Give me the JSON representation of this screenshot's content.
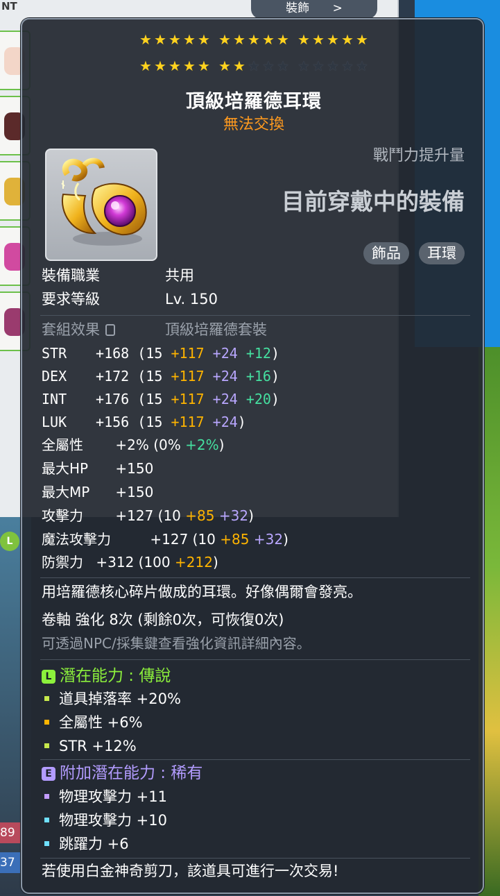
{
  "background": {
    "equip_window_title": "NT",
    "tab_button_label": "裝飾",
    "tab_button_arrow": ">",
    "level_badge": "L",
    "hp_text": "89",
    "mp_text": "37"
  },
  "tooltip": {
    "stars": {
      "total": 25,
      "filled": 22,
      "rows": [
        [
          [
            1,
            1,
            1,
            1,
            1
          ],
          [
            1,
            1,
            1,
            1,
            1
          ],
          [
            1,
            1,
            1,
            1,
            1
          ]
        ],
        [
          [
            1,
            1,
            1,
            1,
            1
          ],
          [
            1,
            1,
            0,
            0,
            0
          ],
          [
            0,
            0,
            0,
            0,
            0
          ]
        ]
      ]
    },
    "title": "頂級培羅德耳環",
    "trade_status": "無法交換",
    "combat_power_label": "戰鬥力提升量",
    "equipped_label": "目前穿戴中的裝備",
    "tags": [
      "飾品",
      "耳環"
    ],
    "job": {
      "label": "裝備職業",
      "value": "共用"
    },
    "req_level": {
      "label": "要求等級",
      "value": "Lv. 150"
    },
    "set": {
      "label": "套組效果",
      "value": "頂級培羅德套裝"
    },
    "stats": [
      {
        "name": "STR",
        "total": "+168",
        "base": "(15",
        "flame": "+117",
        "enhance": "+24",
        "extra": "+12",
        "close": ")"
      },
      {
        "name": "DEX",
        "total": "+172",
        "base": "(15",
        "flame": "+117",
        "enhance": "+24",
        "extra": "+16",
        "close": ")"
      },
      {
        "name": "INT",
        "total": "+176",
        "base": "(15",
        "flame": "+117",
        "enhance": "+24",
        "extra": "+20",
        "close": ")"
      },
      {
        "name": "LUK",
        "total": "+156",
        "base": "(15",
        "flame": "+117",
        "enhance": "+24",
        "extra": "",
        "close": ")"
      }
    ],
    "all_stat": {
      "name": "全屬性",
      "total": "+2%",
      "base": "(0%",
      "extra": "+2%",
      "close": ")"
    },
    "max_hp": {
      "name": "最大HP",
      "total": "+150"
    },
    "max_mp": {
      "name": "最大MP",
      "total": "+150"
    },
    "attack": {
      "name": "攻擊力",
      "total": "+127",
      "base": "(10",
      "flame": "+85",
      "enhance": "+32",
      "close": ")"
    },
    "magic_attack": {
      "name": "魔法攻擊力",
      "total": "+127",
      "base": "(10",
      "flame": "+85",
      "enhance": "+32",
      "close": ")"
    },
    "defense": {
      "name": "防禦力",
      "total": "+312",
      "base": "(100",
      "flame": "+212",
      "close": ")"
    },
    "description": "用培羅德核心碎片做成的耳環。好像偶爾會發亮。",
    "scroll_info": "卷軸 強化 8次 (剩餘0次，可恢復0次)",
    "npc_info": "可透過NPC/採集鍵查看強化資訊詳細內容。",
    "potential": {
      "badge": "L",
      "title": "潛在能力 : 傳說",
      "color": "#8cf03c",
      "lines": [
        {
          "text": "道具掉落率 +20%",
          "bullet_color": "#c6e84c"
        },
        {
          "text": "全屬性 +6%",
          "bullet_color": "#ffb400"
        },
        {
          "text": "STR +12%",
          "bullet_color": "#c6e84c"
        }
      ]
    },
    "additional_potential": {
      "badge": "E",
      "title": "附加潛在能力 : 稀有",
      "color": "#b39cff",
      "lines": [
        {
          "text": "物理攻擊力 +11",
          "bullet_color": "#c39cff"
        },
        {
          "text": "物理攻擊力 +10",
          "bullet_color": "#6fe0ff"
        },
        {
          "text": "跳躍力 +6",
          "bullet_color": "#6fe0ff"
        }
      ]
    },
    "footer": "若使用白金神奇剪刀，該道具可進行一次交易!"
  }
}
